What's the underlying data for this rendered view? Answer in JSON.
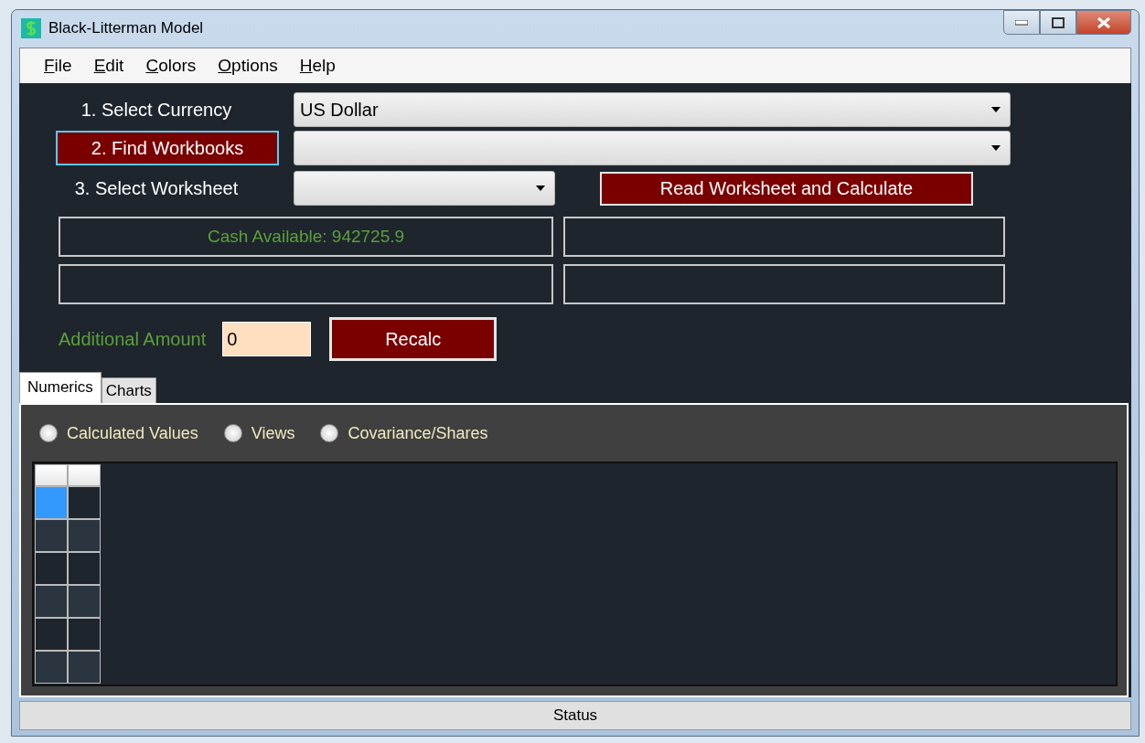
{
  "window": {
    "title": "Black-Litterman Model"
  },
  "menu": [
    "File",
    "Edit",
    "Colors",
    "Options",
    "Help"
  ],
  "form": {
    "currency_label": "1. Select Currency",
    "currency_value": "US Dollar",
    "find_button": "2. Find Workbooks",
    "worksheet_label": "3. Select Worksheet",
    "read_button": "Read Worksheet and Calculate",
    "cash_available": "Cash Available: 942725.9",
    "amount_label": "Additional Amount",
    "amount_value": "0",
    "recalc_button": "Recalc"
  },
  "tabs": [
    {
      "label": "Numerics",
      "selected": true
    },
    {
      "label": "Charts",
      "selected": false
    }
  ],
  "radios": [
    {
      "label": "Calculated Values",
      "selected": false
    },
    {
      "label": "Views",
      "selected": false
    },
    {
      "label": "Covariance/Shares",
      "selected": false
    }
  ],
  "grid": {
    "rows": [
      {
        "cells": [
          {
            "selected": true
          },
          {
            "selected": false
          }
        ]
      },
      {
        "cells": [
          {
            "selected": false
          },
          {
            "selected": false
          }
        ]
      },
      {
        "cells": [
          {
            "selected": false
          },
          {
            "selected": false
          }
        ]
      },
      {
        "cells": [
          {
            "selected": false
          },
          {
            "selected": false
          }
        ]
      },
      {
        "cells": [
          {
            "selected": false
          },
          {
            "selected": false
          }
        ]
      },
      {
        "cells": [
          {
            "selected": false
          },
          {
            "selected": false
          }
        ]
      }
    ]
  },
  "status_bar": "Status"
}
